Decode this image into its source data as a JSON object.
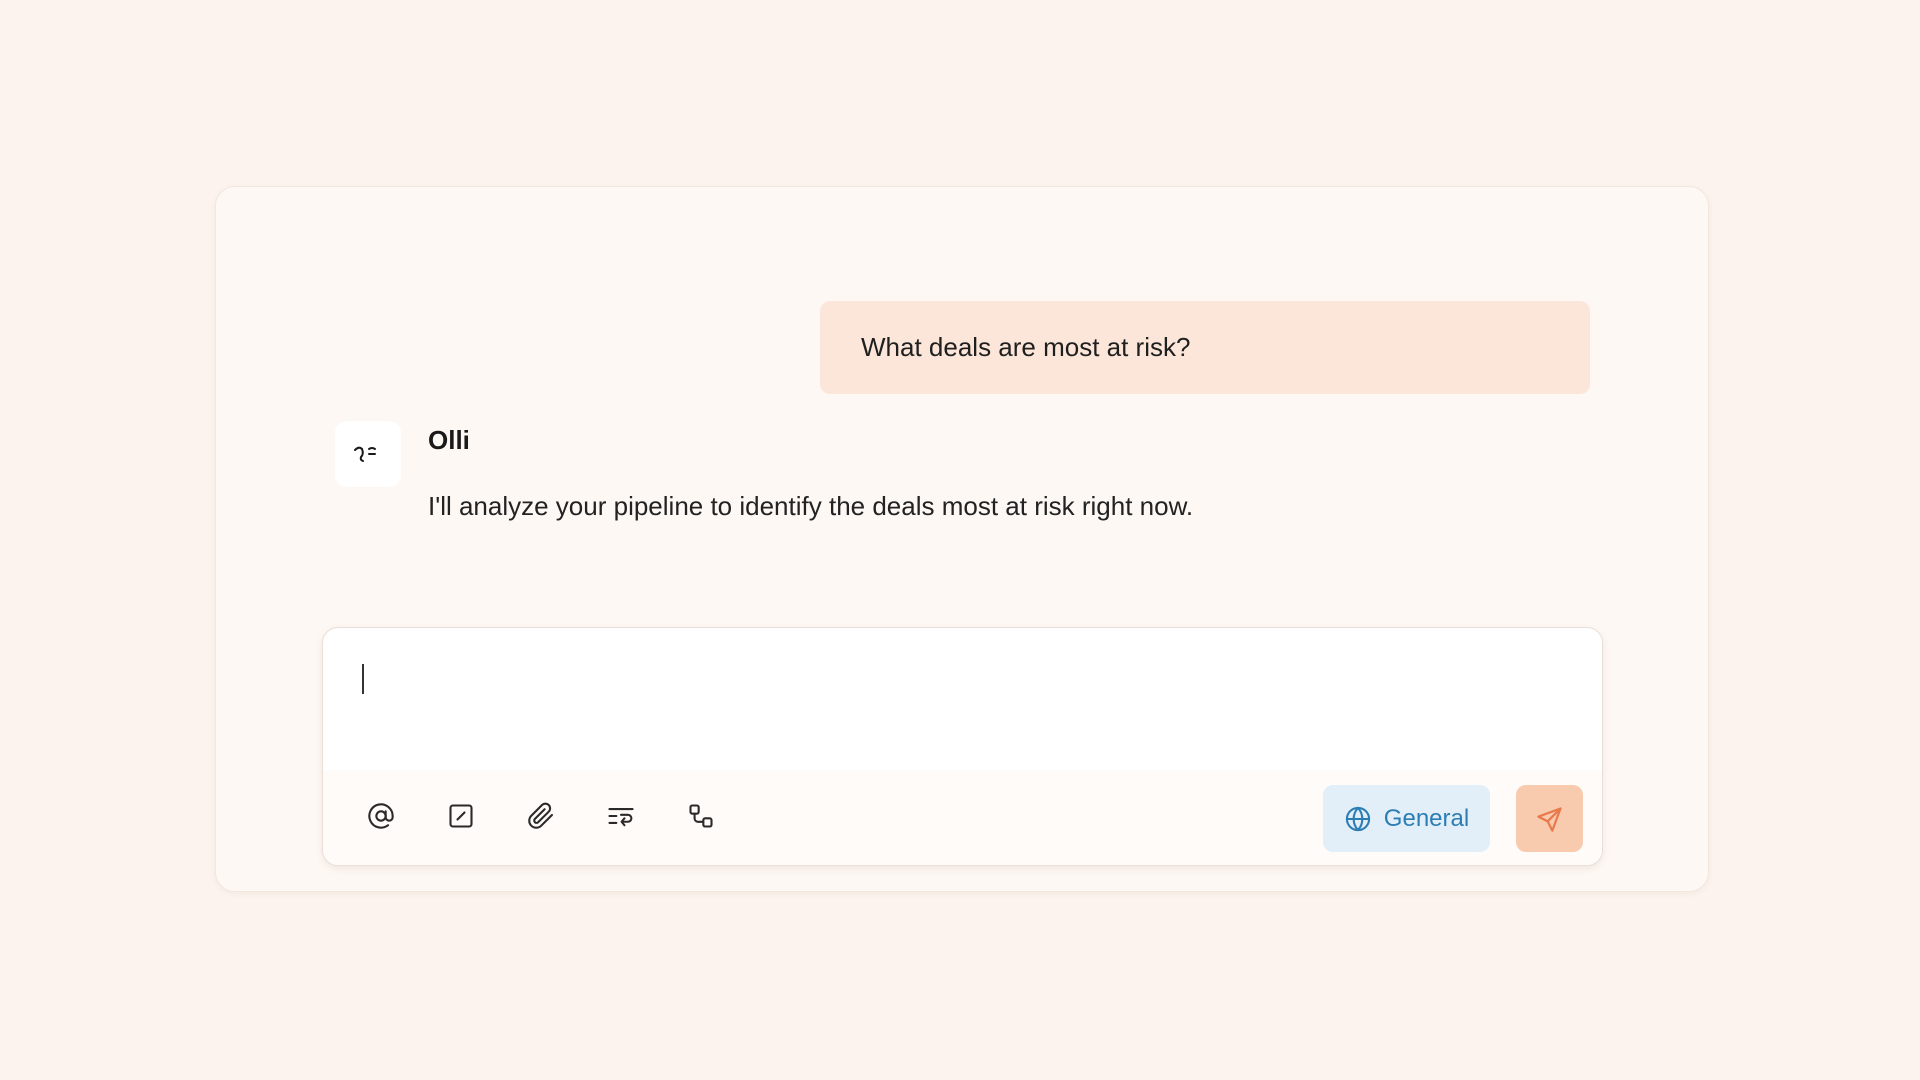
{
  "conversation": {
    "user_message": "What deals are most at risk?",
    "assistant": {
      "name": "Olli",
      "avatar_icon": "olli-face-icon",
      "message": "I'll analyze your pipeline to identify the deals most at risk right now."
    }
  },
  "composer": {
    "input_value": "",
    "tools": [
      {
        "icon": "at-mention-icon"
      },
      {
        "icon": "slash-command-icon"
      },
      {
        "icon": "paperclip-icon"
      },
      {
        "icon": "instructions-icon"
      },
      {
        "icon": "workflow-icon"
      }
    ],
    "scope": {
      "label": "General",
      "icon": "globe-icon"
    },
    "send": {
      "icon": "send-icon"
    }
  },
  "colors": {
    "page_background": "#FCF3EE",
    "user_bubble": "#FBE6D9",
    "scope_background": "#E3EFF8",
    "scope_text": "#2C7DB4",
    "send_background": "#F8CBAE",
    "send_icon": "#E9794A"
  }
}
